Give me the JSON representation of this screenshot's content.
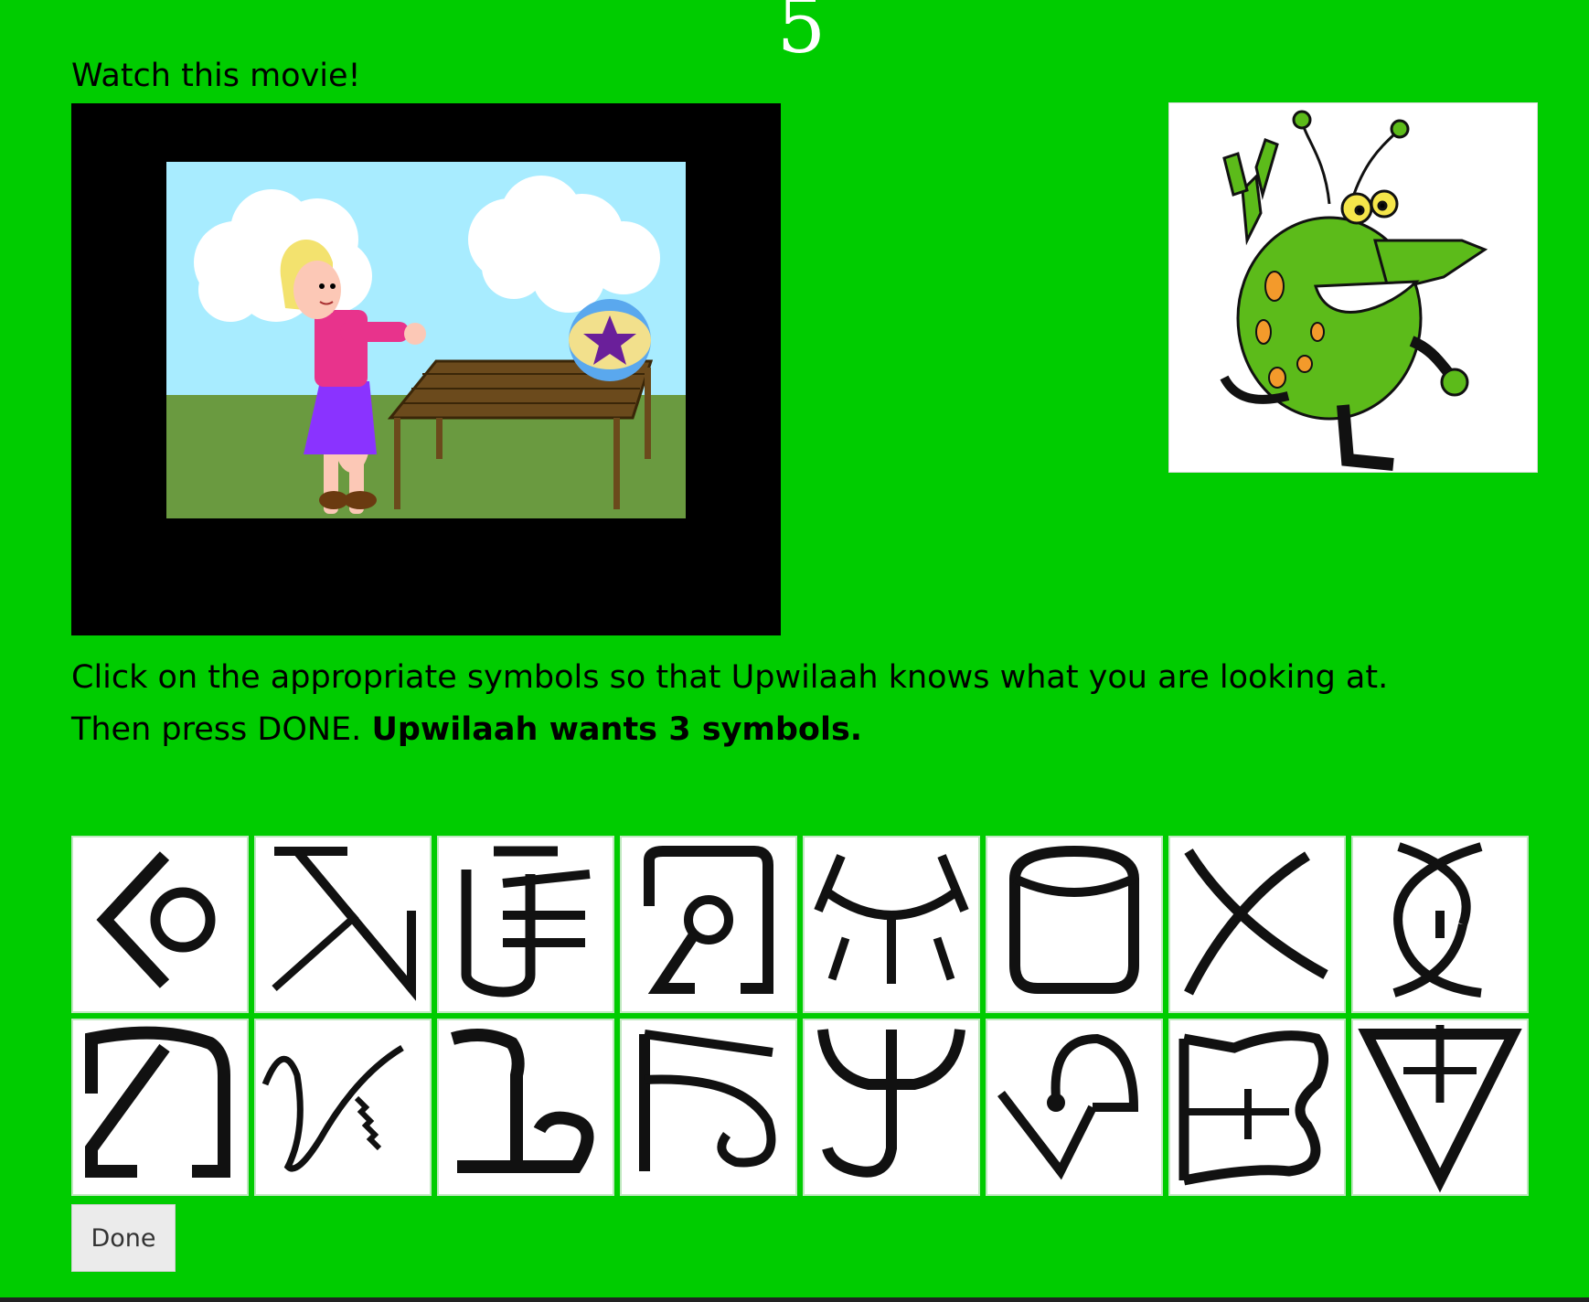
{
  "page": {
    "counter": "5",
    "watch_label": "Watch this movie!",
    "instruction_line1": "Click on the appropriate symbols so that Upwilaah knows what you are looking at.",
    "instruction_line2": "Then press DONE.",
    "instruction_emphasis": "Upwilaah wants 3 symbols.",
    "done_label": "Done"
  },
  "colors": {
    "background": "#00cc00",
    "movie_frame": "#000000",
    "symbol_tile": "#ffffff"
  },
  "movie": {
    "scene": "girl-pushing-ball-on-table",
    "icon": "movie-scene"
  },
  "alien": {
    "icon": "green-alien-waving-icon"
  },
  "symbols": [
    {
      "icon": "symbol-glyph-1"
    },
    {
      "icon": "symbol-glyph-2"
    },
    {
      "icon": "symbol-glyph-3"
    },
    {
      "icon": "symbol-glyph-4"
    },
    {
      "icon": "symbol-glyph-5"
    },
    {
      "icon": "symbol-glyph-6"
    },
    {
      "icon": "symbol-glyph-7"
    },
    {
      "icon": "symbol-glyph-8"
    },
    {
      "icon": "symbol-glyph-9"
    },
    {
      "icon": "symbol-glyph-10"
    },
    {
      "icon": "symbol-glyph-11"
    },
    {
      "icon": "symbol-glyph-12"
    },
    {
      "icon": "symbol-glyph-13"
    },
    {
      "icon": "symbol-glyph-14"
    },
    {
      "icon": "symbol-glyph-15"
    },
    {
      "icon": "symbol-glyph-16"
    }
  ]
}
